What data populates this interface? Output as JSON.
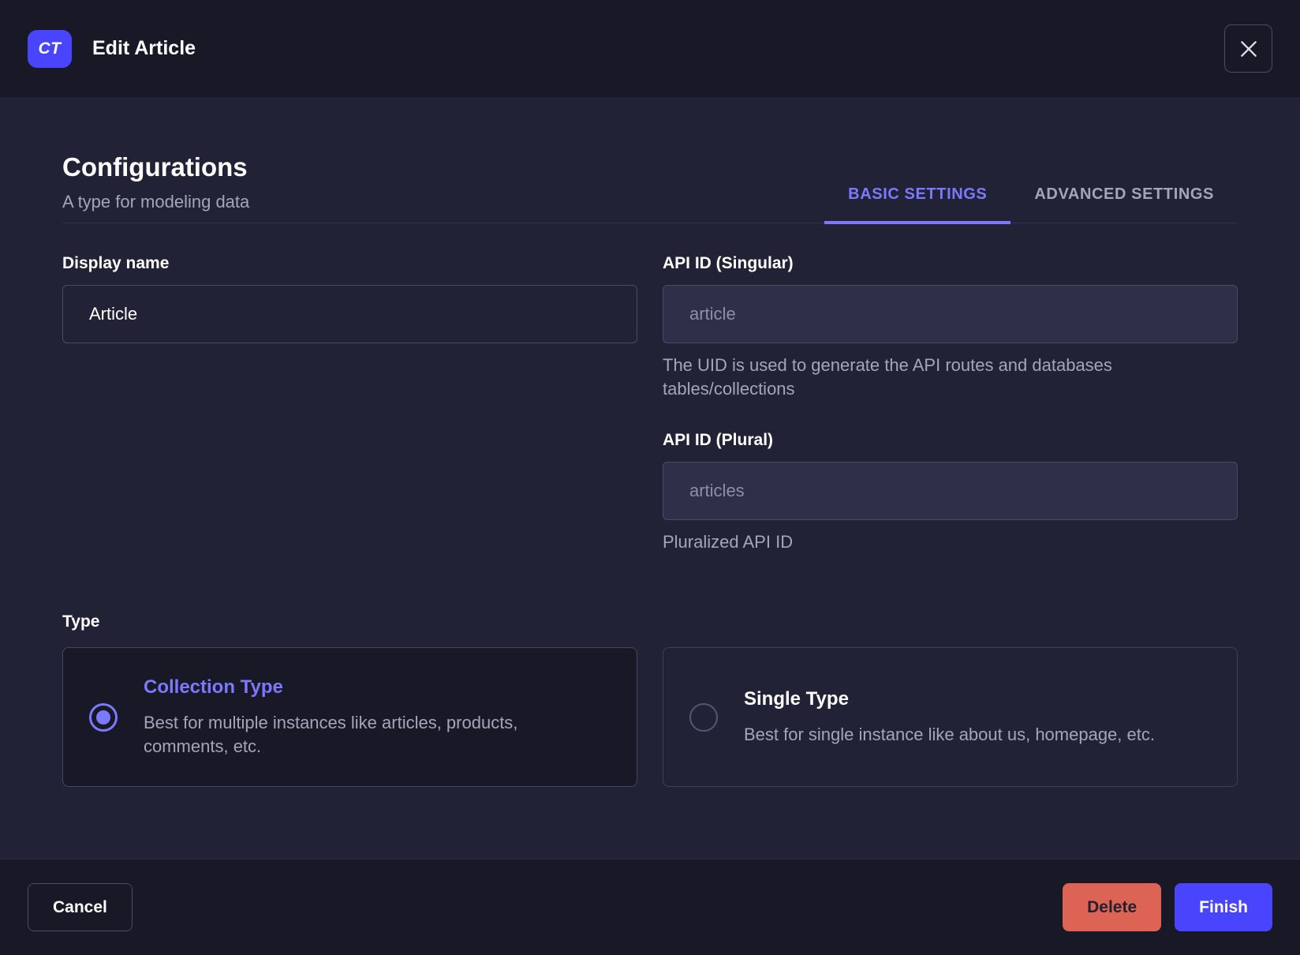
{
  "colors": {
    "primary": "#4945ff",
    "primary_light": "#7b79ff",
    "danger": "#dd6454",
    "background_body": "#222236",
    "background_header_footer": "#181826",
    "border": "#4a4a6a",
    "text_muted": "#a5a5ba"
  },
  "header": {
    "badge": "CT",
    "title": "Edit Article",
    "close_icon": "x-icon"
  },
  "config": {
    "title": "Configurations",
    "subtitle": "A type for modeling data",
    "tabs": [
      {
        "label": "BASIC SETTINGS",
        "active": true
      },
      {
        "label": "ADVANCED SETTINGS",
        "active": false
      }
    ]
  },
  "form": {
    "display_name": {
      "label": "Display name",
      "value": "Article"
    },
    "api_id_singular": {
      "label": "API ID (Singular)",
      "placeholder": "article",
      "hint": "The UID is used to generate the API routes and databases tables/collections"
    },
    "api_id_plural": {
      "label": "API ID (Plural)",
      "placeholder": "articles",
      "hint": "Pluralized API ID"
    },
    "type": {
      "label": "Type",
      "options": [
        {
          "title": "Collection Type",
          "description": "Best for multiple instances like articles, products, comments, etc.",
          "selected": true
        },
        {
          "title": "Single Type",
          "description": "Best for single instance like about us, homepage, etc.",
          "selected": false
        }
      ]
    }
  },
  "footer": {
    "cancel": "Cancel",
    "delete": "Delete",
    "finish": "Finish"
  }
}
